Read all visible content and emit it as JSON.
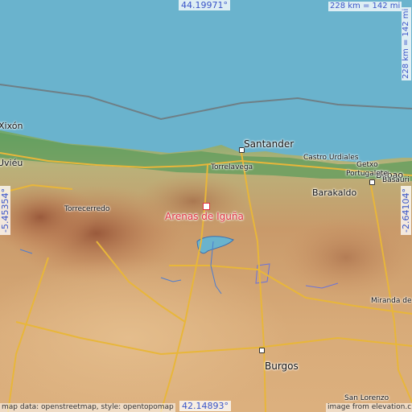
{
  "map": {
    "focus_place": "Arenas de Iguña",
    "focus_color": "#e03040",
    "sea_color": "#6ab3cd",
    "coordinates": {
      "top": "44.19971°",
      "bottom": "42.14893°",
      "left": "-5.45354°",
      "right": "-2.64104°"
    },
    "scale": {
      "horizontal": "228 km = 142 mi",
      "vertical": "228 km = 142 mi"
    },
    "places": [
      {
        "name": "Xixón",
        "size": "large"
      },
      {
        "name": "Santander",
        "size": "large"
      },
      {
        "name": "Torrelavega",
        "size": "small"
      },
      {
        "name": "Castro Urdiales",
        "size": "small"
      },
      {
        "name": "Bilbao",
        "size": "medium"
      },
      {
        "name": "Getxo",
        "size": "small"
      },
      {
        "name": "Basauri",
        "size": "small"
      },
      {
        "name": "Portugalete",
        "size": "small"
      },
      {
        "name": "Barakaldo",
        "size": "medium"
      },
      {
        "name": "Torrecerredo",
        "size": "small"
      },
      {
        "name": "Miranda de Ebro",
        "size": "small"
      },
      {
        "name": "Burgos",
        "size": "medium"
      },
      {
        "name": "San Lorenzo",
        "size": "small"
      },
      {
        "name": "Uviéu",
        "size": "medium"
      }
    ],
    "credits": {
      "left": "map data: openstreetmap, style: opentopomap",
      "right": "image from elevation.city"
    }
  }
}
